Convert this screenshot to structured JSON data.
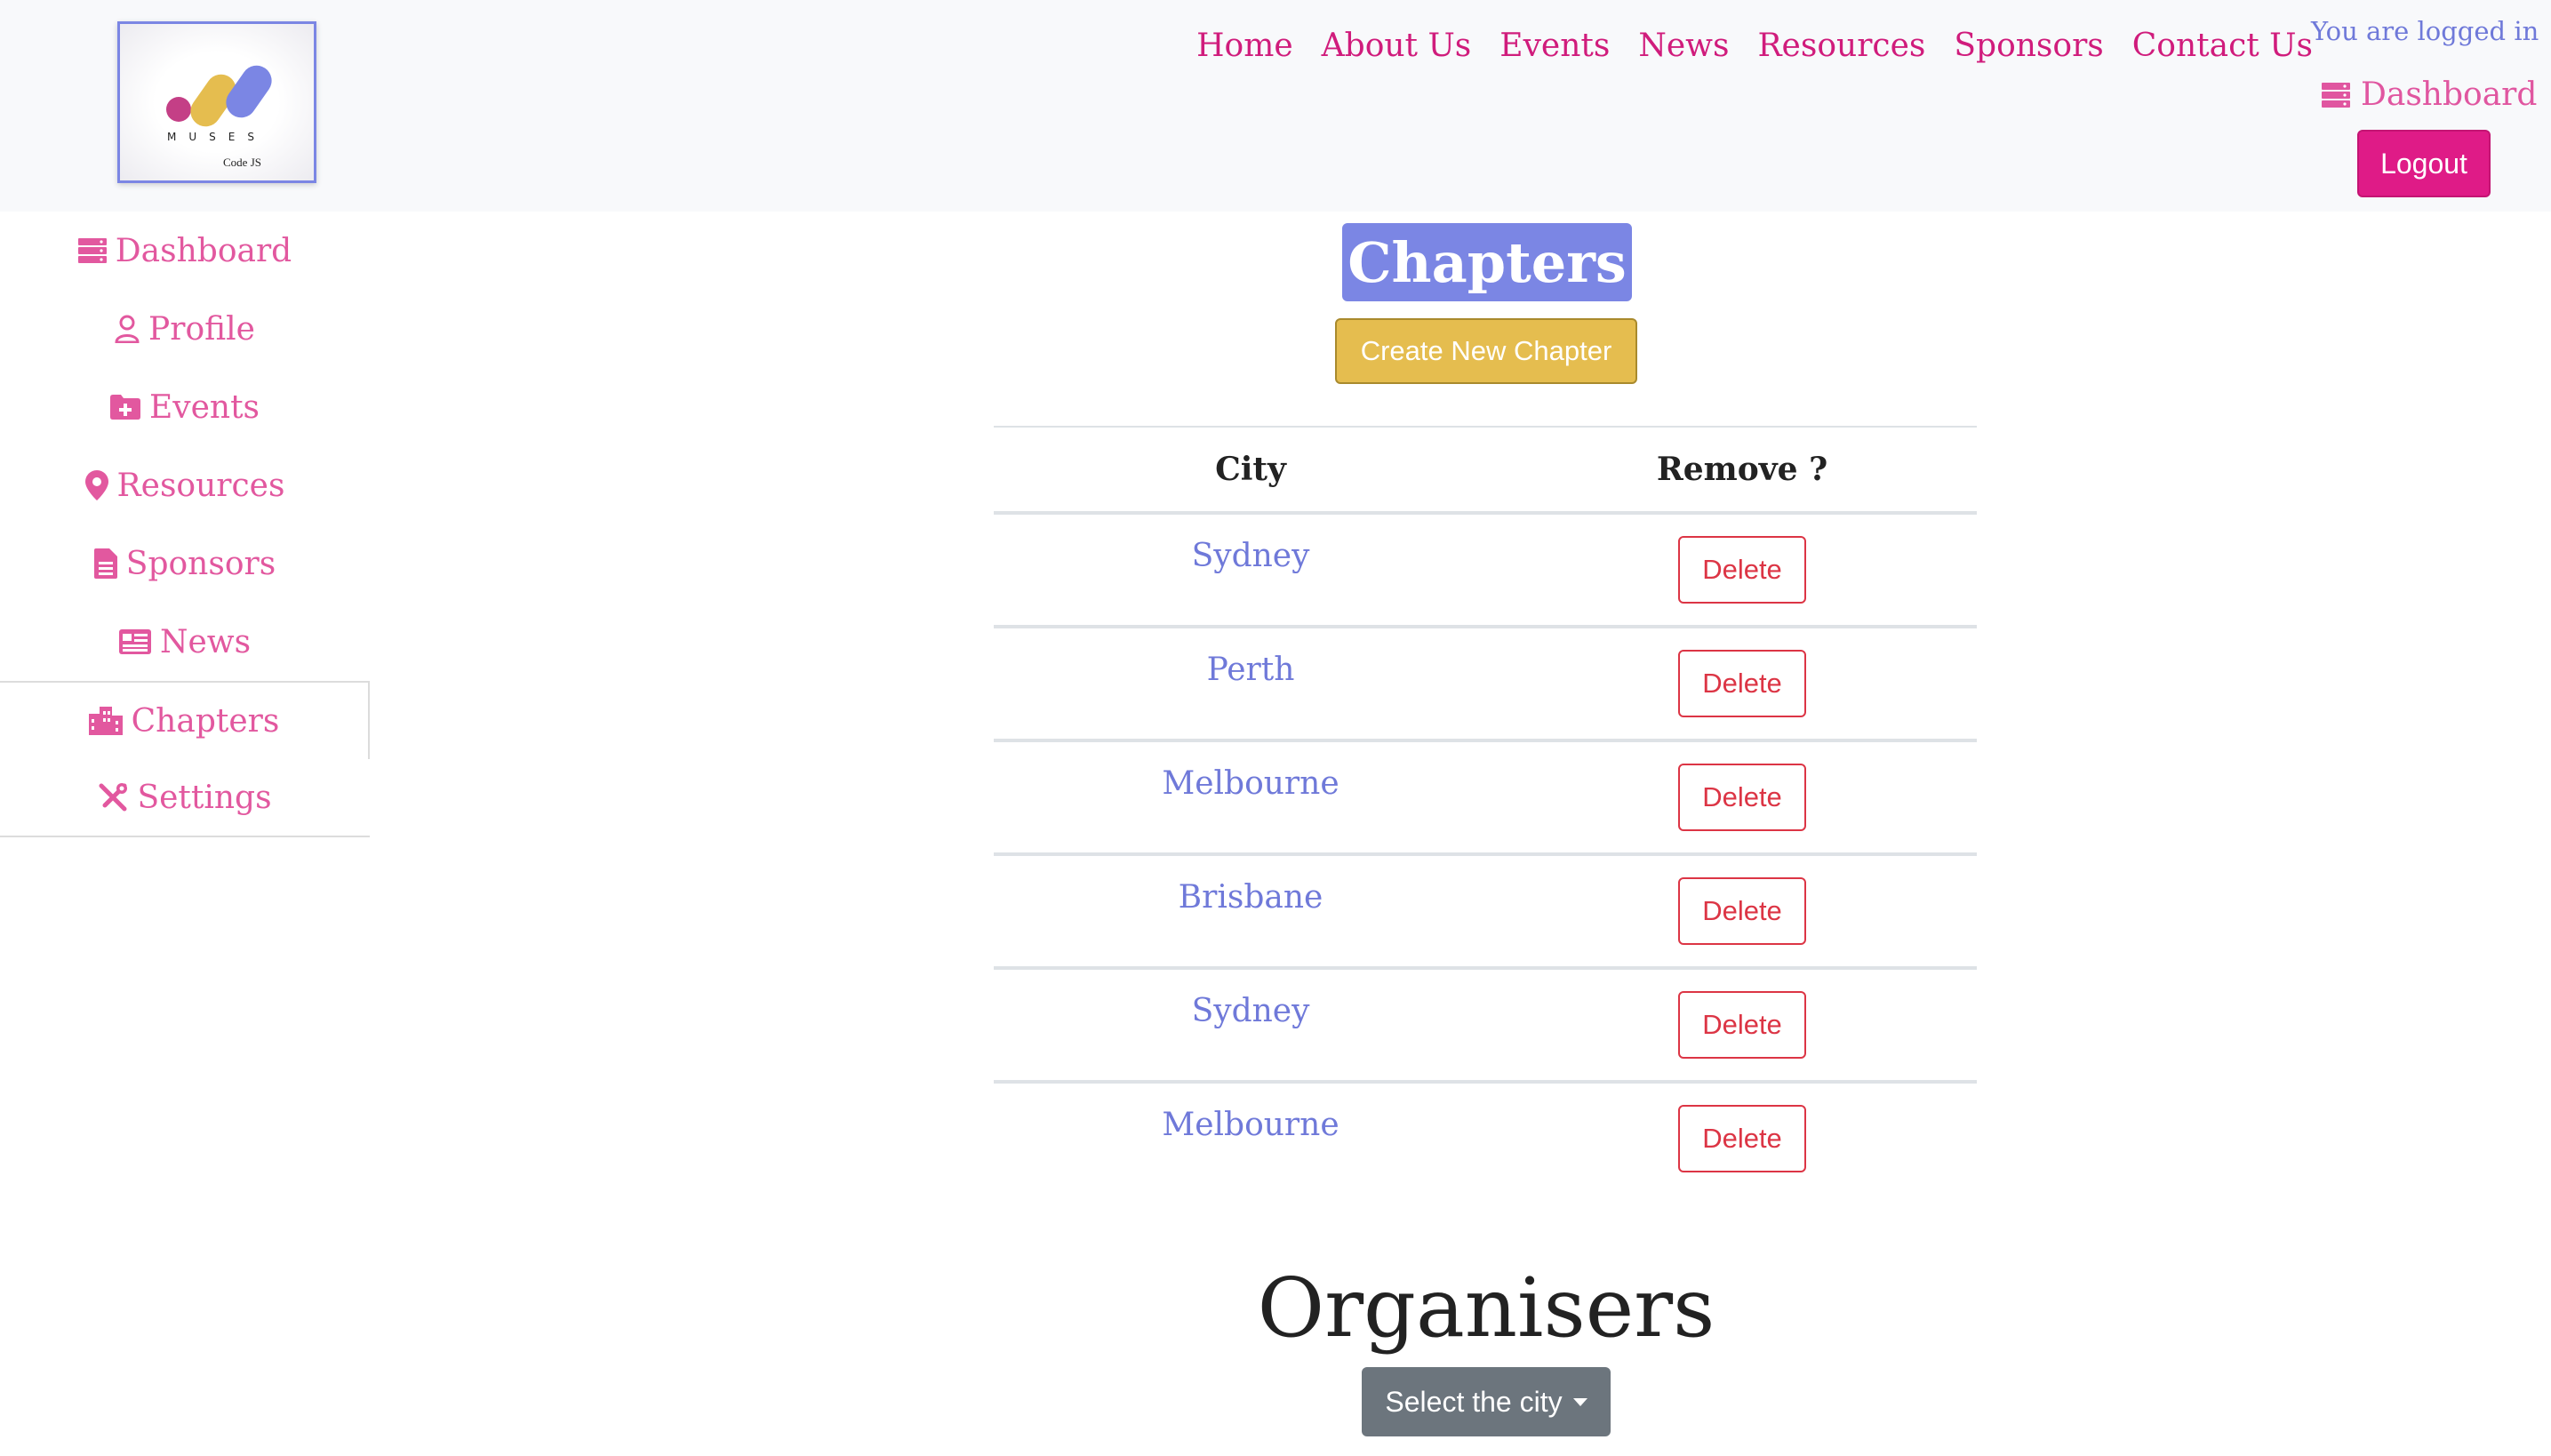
{
  "brand": {
    "logo_text": "MUSES",
    "logo_subtext": "Code JS"
  },
  "topnav": [
    "Home",
    "About Us",
    "Events",
    "News",
    "Resources",
    "Sponsors",
    "Contact Us"
  ],
  "auth": {
    "status": "You are logged in",
    "dashboard_label": "Dashboard",
    "logout_label": "Logout"
  },
  "sidebar": {
    "items": [
      {
        "label": "Dashboard",
        "icon": "server-icon"
      },
      {
        "label": "Profile",
        "icon": "user-icon"
      },
      {
        "label": "Events",
        "icon": "folder-plus-icon"
      },
      {
        "label": "Resources",
        "icon": "map-pin-icon"
      },
      {
        "label": "Sponsors",
        "icon": "file-icon"
      },
      {
        "label": "News",
        "icon": "newspaper-icon"
      },
      {
        "label": "Chapters",
        "icon": "building-icon",
        "active": true
      },
      {
        "label": "Settings",
        "icon": "tools-icon"
      }
    ]
  },
  "main": {
    "title": "Chapters",
    "create_label": "Create New Chapter",
    "table": {
      "headers": [
        "City",
        "Remove ?"
      ],
      "delete_label": "Delete",
      "rows": [
        "Sydney",
        "Perth",
        "Melbourne",
        "Brisbane",
        "Sydney",
        "Melbourne"
      ]
    },
    "organisers_title": "Organisers",
    "select_city_label": "Select the city"
  },
  "colors": {
    "accent_pink": "#d01c7c",
    "accent_blue": "#7b86e4",
    "create_yellow": "#e5bd4f",
    "delete_red": "#dc3545",
    "select_gray": "#6c757d"
  }
}
